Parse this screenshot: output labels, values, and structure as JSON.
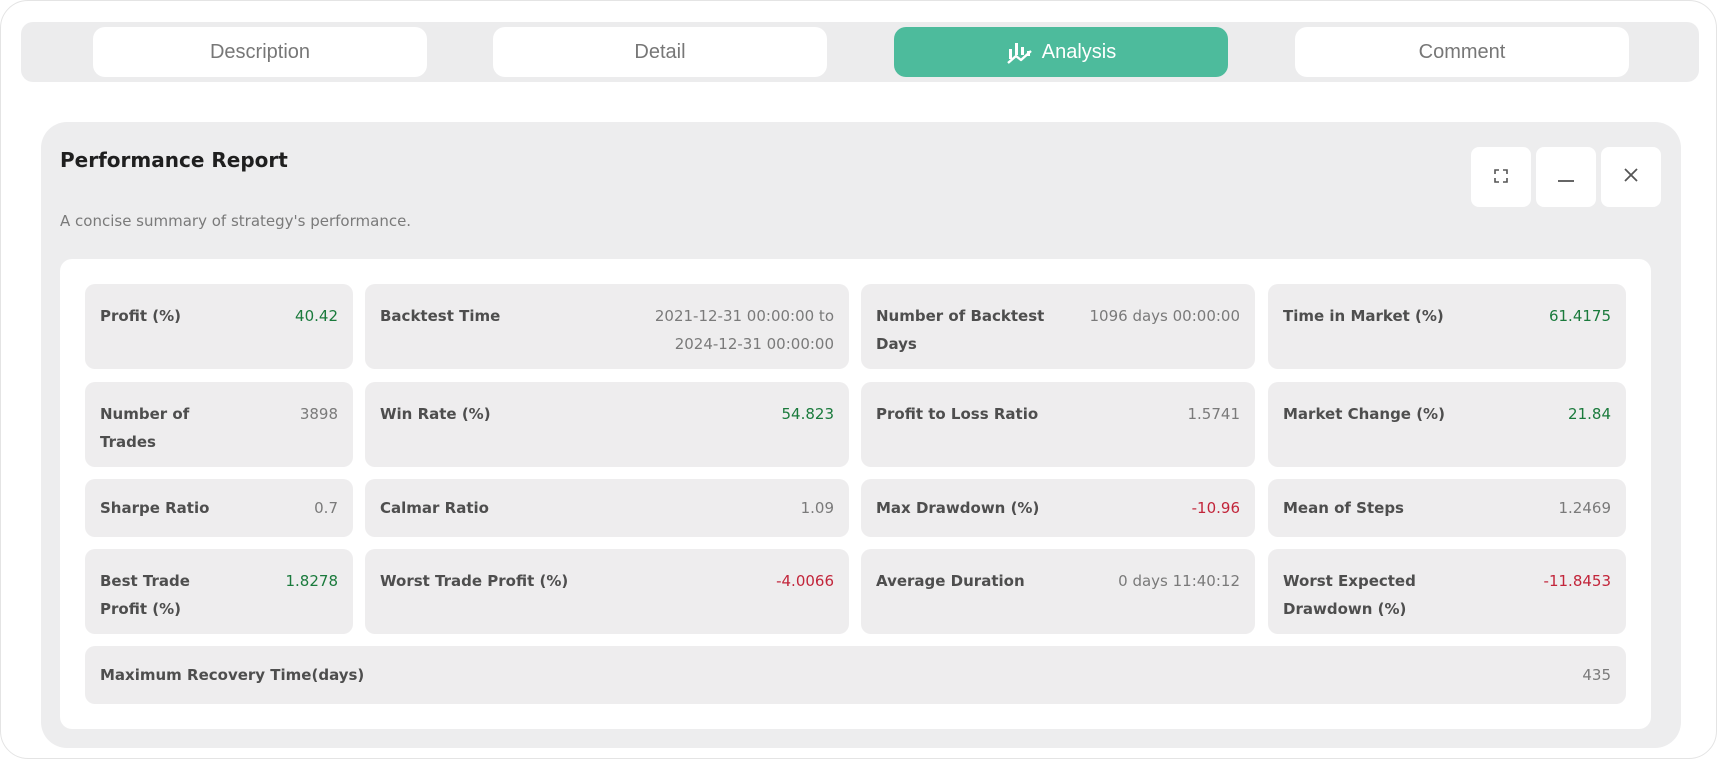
{
  "tabs": [
    {
      "label": "Description",
      "active": false
    },
    {
      "label": "Detail",
      "active": false
    },
    {
      "label": "Analysis",
      "active": true,
      "icon": "analysis-chart-icon"
    },
    {
      "label": "Comment",
      "active": false
    }
  ],
  "report": {
    "title": "Performance Report",
    "subtitle": "A concise summary of strategy's performance.",
    "controls": [
      "fullscreen-icon",
      "minimize-icon",
      "close-icon"
    ]
  },
  "colors": {
    "accent": "#4dbb9c",
    "positive": "#1a7a3c",
    "negative": "#c2253a",
    "neutral": "#7a7a7a"
  },
  "metrics": [
    {
      "label": "Profit (%)",
      "value": "40.42",
      "tone": "pos"
    },
    {
      "label": "Backtest Time",
      "value": "2021-12-31 00:00:00 to 2024-12-31 00:00:00",
      "tone": "neu"
    },
    {
      "label": "Number of Backtest Days",
      "value": "1096 days 00:00:00",
      "tone": "neu"
    },
    {
      "label": "Time in Market (%)",
      "value": "61.4175",
      "tone": "pos"
    },
    {
      "label": "Number of Trades",
      "value": "3898",
      "tone": "neu"
    },
    {
      "label": "Win Rate (%)",
      "value": "54.823",
      "tone": "pos"
    },
    {
      "label": "Profit to Loss Ratio",
      "value": "1.5741",
      "tone": "neu"
    },
    {
      "label": "Market Change (%)",
      "value": "21.84",
      "tone": "pos"
    },
    {
      "label": "Sharpe Ratio",
      "value": "0.7",
      "tone": "neu"
    },
    {
      "label": "Calmar Ratio",
      "value": "1.09",
      "tone": "neu"
    },
    {
      "label": "Max Drawdown (%)",
      "value": "-10.96",
      "tone": "neg"
    },
    {
      "label": "Mean of Steps",
      "value": "1.2469",
      "tone": "neu"
    },
    {
      "label": "Best Trade Profit (%)",
      "value": "1.8278",
      "tone": "pos"
    },
    {
      "label": "Worst Trade Profit (%)",
      "value": "-4.0066",
      "tone": "neg"
    },
    {
      "label": "Average Duration",
      "value": "0 days 11:40:12",
      "tone": "neu"
    },
    {
      "label": "Worst Expected Drawdown (%)",
      "value": "-11.8453",
      "tone": "neg"
    },
    {
      "label": "Maximum Recovery Time(days)",
      "value": "435",
      "tone": "neu"
    }
  ]
}
